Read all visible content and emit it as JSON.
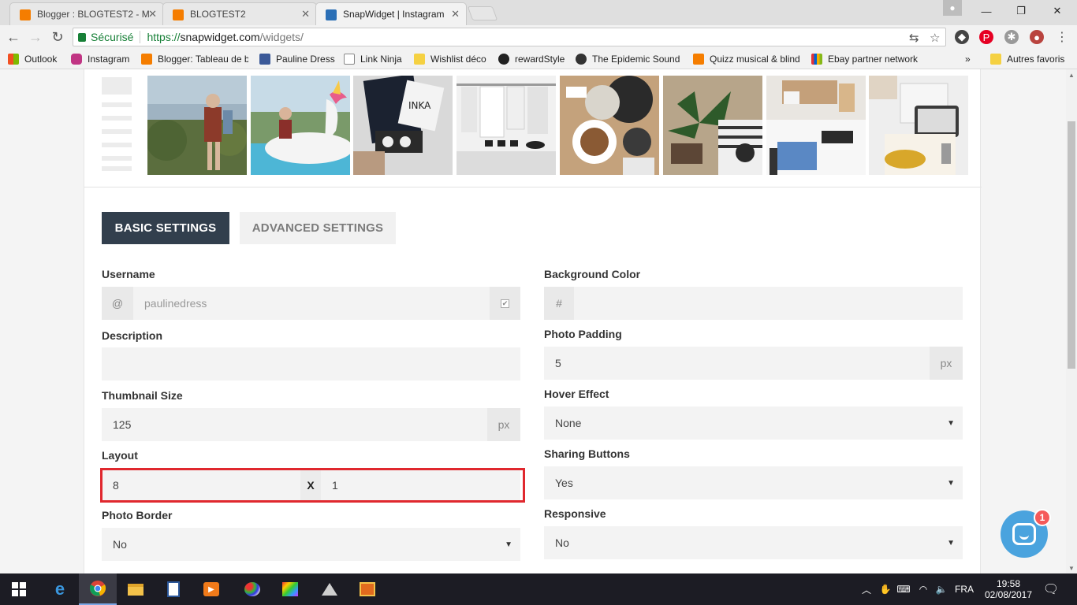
{
  "browser": {
    "tabs": [
      {
        "title": "Blogger : BLOGTEST2 - M",
        "color": "#f57d00"
      },
      {
        "title": "BLOGTEST2",
        "color": "#f57d00"
      },
      {
        "title": "SnapWidget | Instagram",
        "color": "#2b6fb6"
      }
    ],
    "address": {
      "secure_label": "Sécurisé",
      "scheme": "https://",
      "host": "snapwidget.com",
      "path": "/widgets/"
    },
    "bookmarks": [
      {
        "label": "Outlook",
        "color": "#0a64d6"
      },
      {
        "label": "Instagram",
        "color": "#c13584"
      },
      {
        "label": "Blogger: Tableau de b",
        "color": "#f57d00"
      },
      {
        "label": "Pauline Dress",
        "color": "#3b5998"
      },
      {
        "label": "Link Ninja",
        "color": "#ffffff"
      },
      {
        "label": "Wishlist déco",
        "color": "#f5d142"
      },
      {
        "label": "rewardStyle",
        "color": "#222222"
      },
      {
        "label": "The Epidemic Sound",
        "color": "#333333"
      },
      {
        "label": "Quizz musical & blind",
        "color": "#f57d00"
      },
      {
        "label": "Ebay partner network",
        "color": "#e53238"
      }
    ],
    "bookmarks_overflow": "»",
    "other_bookmarks": "Autres favoris"
  },
  "settings": {
    "tabs": {
      "basic": "BASIC SETTINGS",
      "advanced": "ADVANCED SETTINGS"
    },
    "left": {
      "username": {
        "label": "Username",
        "prefix": "@",
        "value": "paulinedress"
      },
      "description": {
        "label": "Description",
        "value": ""
      },
      "thumbnail": {
        "label": "Thumbnail Size",
        "value": "125",
        "unit": "px"
      },
      "layout": {
        "label": "Layout",
        "columns": "8",
        "sep": "X",
        "rows": "1"
      },
      "photo_border": {
        "label": "Photo Border",
        "value": "No"
      }
    },
    "right": {
      "background": {
        "label": "Background Color",
        "prefix": "#",
        "value": ""
      },
      "padding": {
        "label": "Photo Padding",
        "value": "5",
        "unit": "px"
      },
      "hover": {
        "label": "Hover Effect",
        "value": "None"
      },
      "sharing": {
        "label": "Sharing Buttons",
        "value": "Yes"
      },
      "responsive": {
        "label": "Responsive",
        "value": "No"
      }
    }
  },
  "chat": {
    "badge": "1"
  },
  "taskbar": {
    "lang": "FRA",
    "time": "19:58",
    "date": "02/08/2017"
  }
}
